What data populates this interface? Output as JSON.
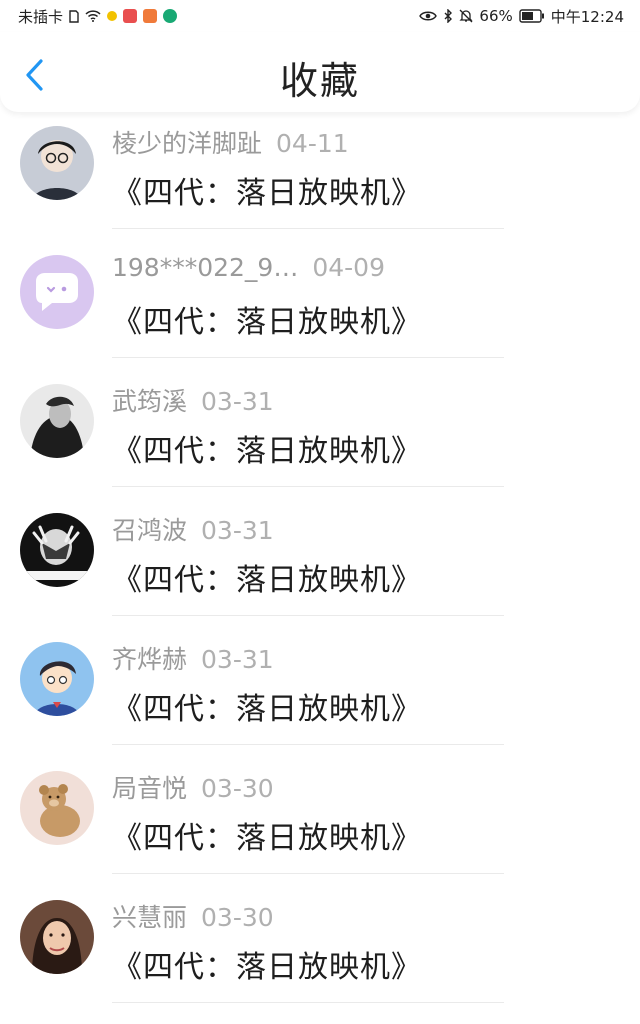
{
  "status": {
    "carrier": "未插卡",
    "battery": "66%",
    "time": "中午12:24",
    "icons": [
      "sim-icon",
      "wifi-icon",
      "eye-icon",
      "bluetooth-icon",
      "mute-icon",
      "battery-icon"
    ]
  },
  "header": {
    "title": "收藏",
    "back_icon": "chevron-left-icon",
    "accent": "#2196f3"
  },
  "favorites": [
    {
      "user": "棱少的洋脚趾",
      "date": "04-11",
      "book": "《四代：落日放映机》",
      "avatar": "boy-with-glasses"
    },
    {
      "user": "198***022_9…",
      "date": "04-09",
      "book": "《四代：落日放映机》",
      "avatar": "default-chat-bubble"
    },
    {
      "user": "武筠溪",
      "date": "03-31",
      "book": "《四代：落日放映机》",
      "avatar": "mono-portrait"
    },
    {
      "user": "召鸿波",
      "date": "03-31",
      "book": "《四代：落日放映机》",
      "avatar": "hand-over-face"
    },
    {
      "user": "齐烨赫",
      "date": "03-31",
      "book": "《四代：落日放映机》",
      "avatar": "cartoon-detective"
    },
    {
      "user": "局音悦",
      "date": "03-30",
      "book": "《四代：落日放映机》",
      "avatar": "teddy-bear"
    },
    {
      "user": "兴慧丽",
      "date": "03-30",
      "book": "《四代：落日放映机》",
      "avatar": "woman-portrait"
    }
  ]
}
